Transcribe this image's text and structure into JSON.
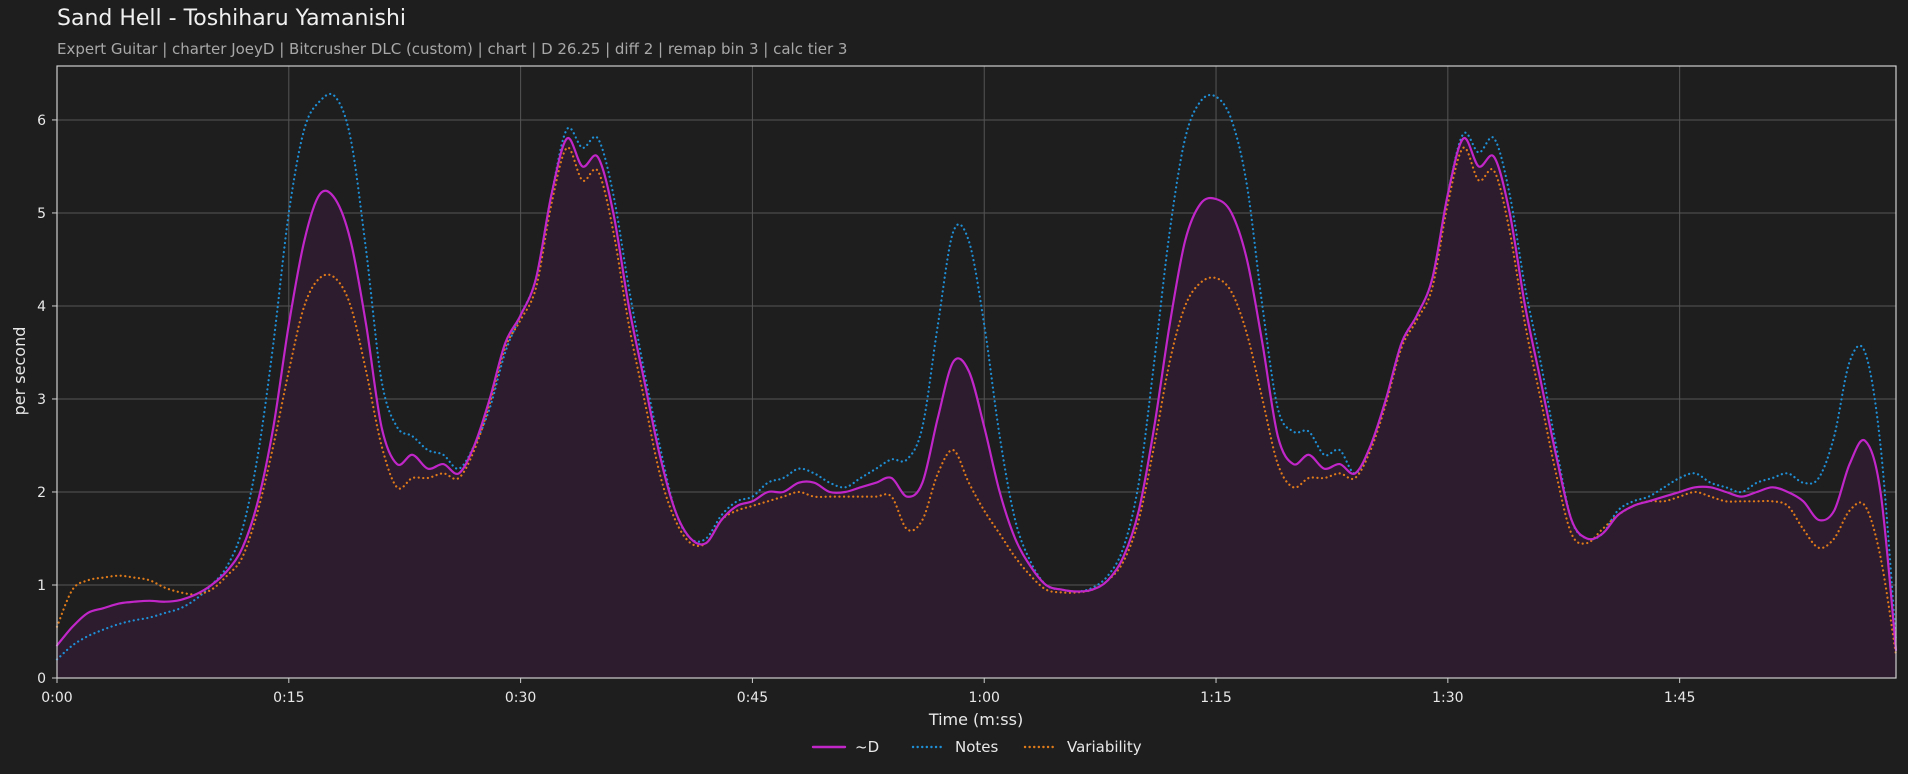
{
  "chart_title": "Sand Hell - Toshiharu Yamanishi",
  "chart_subtitle": "Expert Guitar  |  charter JoeyD  |  Bitcrusher DLC (custom)  |  chart  |  D 26.25  |  diff 2  |  remap bin 3  |  calc tier 3",
  "chart_data": {
    "type": "line",
    "title": "Sand Hell - Toshiharu Yamanishi",
    "xlabel": "Time (m:ss)",
    "ylabel": "per second",
    "xlim": [
      0,
      119
    ],
    "ylim": [
      0,
      6.58
    ],
    "x_ticks": [
      0,
      15,
      30,
      45,
      60,
      75,
      90,
      105
    ],
    "x_tick_labels": [
      "0:00",
      "0:15",
      "0:30",
      "0:45",
      "1:00",
      "1:15",
      "1:30",
      "1:45"
    ],
    "y_ticks": [
      0,
      1,
      2,
      3,
      4,
      5,
      6
    ],
    "y_tick_labels": [
      "0",
      "1",
      "2",
      "3",
      "4",
      "5",
      "6"
    ],
    "grid": true,
    "legend_position": "bottom-center",
    "x": [
      0,
      1,
      2,
      3,
      4,
      5,
      6,
      7,
      8,
      9,
      10,
      11,
      12,
      13,
      14,
      15,
      16,
      17,
      18,
      19,
      20,
      21,
      22,
      23,
      24,
      25,
      26,
      27,
      28,
      29,
      30,
      31,
      32,
      33,
      34,
      35,
      36,
      37,
      38,
      39,
      40,
      41,
      42,
      43,
      44,
      45,
      46,
      47,
      48,
      49,
      50,
      51,
      52,
      53,
      54,
      55,
      56,
      57,
      58,
      59,
      60,
      61,
      62,
      63,
      64,
      65,
      66,
      67,
      68,
      69,
      70,
      71,
      72,
      73,
      74,
      75,
      76,
      77,
      78,
      79,
      80,
      81,
      82,
      83,
      84,
      85,
      86,
      87,
      88,
      89,
      90,
      91,
      92,
      93,
      94,
      95,
      96,
      97,
      98,
      99,
      100,
      101,
      102,
      103,
      104,
      105,
      106,
      107,
      108,
      109,
      110,
      111,
      112,
      113,
      114,
      115,
      116,
      117,
      118,
      119
    ],
    "series": [
      {
        "name": "~D",
        "color": "#c026c8",
        "style": "solid",
        "fill": true,
        "values": [
          0.35,
          0.55,
          0.7,
          0.75,
          0.8,
          0.82,
          0.83,
          0.82,
          0.84,
          0.9,
          1.0,
          1.15,
          1.4,
          1.9,
          2.7,
          3.8,
          4.7,
          5.2,
          5.15,
          4.7,
          3.8,
          2.7,
          2.3,
          2.4,
          2.25,
          2.3,
          2.2,
          2.5,
          3.0,
          3.6,
          3.9,
          4.3,
          5.2,
          5.8,
          5.5,
          5.6,
          5.0,
          4.0,
          3.2,
          2.4,
          1.8,
          1.5,
          1.45,
          1.7,
          1.85,
          1.9,
          2.0,
          2.0,
          2.1,
          2.1,
          2.0,
          2.0,
          2.05,
          2.1,
          2.15,
          1.95,
          2.1,
          2.8,
          3.4,
          3.3,
          2.7,
          2.0,
          1.5,
          1.2,
          1.0,
          0.95,
          0.93,
          0.95,
          1.05,
          1.3,
          1.8,
          2.7,
          3.8,
          4.7,
          5.1,
          5.15,
          5.0,
          4.5,
          3.6,
          2.6,
          2.3,
          2.4,
          2.25,
          2.3,
          2.2,
          2.5,
          3.0,
          3.6,
          3.9,
          4.3,
          5.2,
          5.8,
          5.5,
          5.6,
          5.0,
          4.0,
          3.2,
          2.4,
          1.7,
          1.5,
          1.55,
          1.75,
          1.85,
          1.9,
          1.95,
          2.0,
          2.05,
          2.05,
          2.0,
          1.95,
          2.0,
          2.05,
          2.0,
          1.9,
          1.7,
          1.8,
          2.3,
          2.55,
          2.0,
          0.3
        ]
      },
      {
        "name": "Notes",
        "color": "#1f8fd6",
        "style": "dotted",
        "fill": false,
        "values": [
          0.2,
          0.35,
          0.45,
          0.52,
          0.58,
          0.62,
          0.65,
          0.7,
          0.75,
          0.85,
          1.0,
          1.2,
          1.6,
          2.4,
          3.6,
          5.0,
          5.9,
          6.2,
          6.25,
          5.8,
          4.6,
          3.2,
          2.7,
          2.6,
          2.45,
          2.4,
          2.25,
          2.5,
          2.9,
          3.5,
          3.9,
          4.3,
          5.2,
          5.9,
          5.7,
          5.8,
          5.2,
          4.2,
          3.3,
          2.5,
          1.8,
          1.5,
          1.5,
          1.75,
          1.9,
          1.95,
          2.1,
          2.15,
          2.25,
          2.2,
          2.1,
          2.05,
          2.15,
          2.25,
          2.35,
          2.35,
          2.7,
          3.8,
          4.8,
          4.7,
          3.8,
          2.6,
          1.7,
          1.25,
          1.0,
          0.95,
          0.93,
          0.97,
          1.1,
          1.4,
          2.1,
          3.4,
          4.8,
          5.8,
          6.2,
          6.25,
          6.0,
          5.3,
          4.0,
          2.9,
          2.65,
          2.65,
          2.4,
          2.45,
          2.2,
          2.5,
          3.0,
          3.6,
          3.9,
          4.3,
          5.2,
          5.85,
          5.65,
          5.8,
          5.2,
          4.2,
          3.4,
          2.5,
          1.7,
          1.5,
          1.55,
          1.8,
          1.9,
          1.95,
          2.05,
          2.15,
          2.2,
          2.1,
          2.05,
          2.0,
          2.1,
          2.15,
          2.2,
          2.1,
          2.15,
          2.6,
          3.4,
          3.5,
          2.5,
          0.4
        ]
      },
      {
        "name": "Variability",
        "color": "#e07b1a",
        "style": "dotted",
        "fill": false,
        "values": [
          0.55,
          0.95,
          1.05,
          1.08,
          1.1,
          1.08,
          1.05,
          0.97,
          0.92,
          0.9,
          0.95,
          1.1,
          1.3,
          1.8,
          2.5,
          3.3,
          4.0,
          4.3,
          4.3,
          4.0,
          3.3,
          2.5,
          2.05,
          2.15,
          2.15,
          2.2,
          2.15,
          2.45,
          2.95,
          3.55,
          3.85,
          4.2,
          5.1,
          5.7,
          5.35,
          5.45,
          4.8,
          3.8,
          3.0,
          2.2,
          1.7,
          1.45,
          1.45,
          1.7,
          1.8,
          1.85,
          1.9,
          1.95,
          2.0,
          1.95,
          1.95,
          1.95,
          1.95,
          1.95,
          1.95,
          1.6,
          1.7,
          2.2,
          2.45,
          2.1,
          1.8,
          1.55,
          1.3,
          1.1,
          0.95,
          0.92,
          0.92,
          0.95,
          1.05,
          1.25,
          1.7,
          2.5,
          3.4,
          4.0,
          4.25,
          4.3,
          4.15,
          3.7,
          3.0,
          2.3,
          2.05,
          2.15,
          2.15,
          2.2,
          2.15,
          2.45,
          2.95,
          3.55,
          3.85,
          4.2,
          5.1,
          5.7,
          5.35,
          5.45,
          4.8,
          3.8,
          3.0,
          2.2,
          1.55,
          1.45,
          1.6,
          1.75,
          1.85,
          1.9,
          1.9,
          1.95,
          2.0,
          1.95,
          1.9,
          1.9,
          1.9,
          1.9,
          1.85,
          1.6,
          1.4,
          1.5,
          1.8,
          1.85,
          1.3,
          0.25
        ]
      }
    ]
  },
  "colors": {
    "background": "#1e1e1e",
    "plot_border": "#cfcfcf",
    "grid": "#555555",
    "area_fill": "#2d1b2e"
  }
}
